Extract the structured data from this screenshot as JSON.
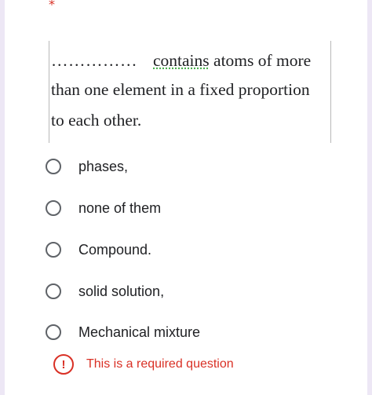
{
  "question": {
    "required_marker": "*",
    "image_text": {
      "blank": "……………",
      "line1_word": "contains",
      "line1_rest": "atoms of more",
      "line2": "than one element in a fixed proportion",
      "line3": "to each other."
    }
  },
  "options": [
    {
      "label": "phases,",
      "selected": false
    },
    {
      "label": "none of them",
      "selected": false
    },
    {
      "label": "Compound.",
      "selected": false
    },
    {
      "label": "solid solution,",
      "selected": false
    },
    {
      "label": "Mechanical mixture",
      "selected": false
    }
  ],
  "validation": {
    "icon": "exclamation-circle-icon",
    "message": "This is a required question",
    "color": "#d93025"
  }
}
